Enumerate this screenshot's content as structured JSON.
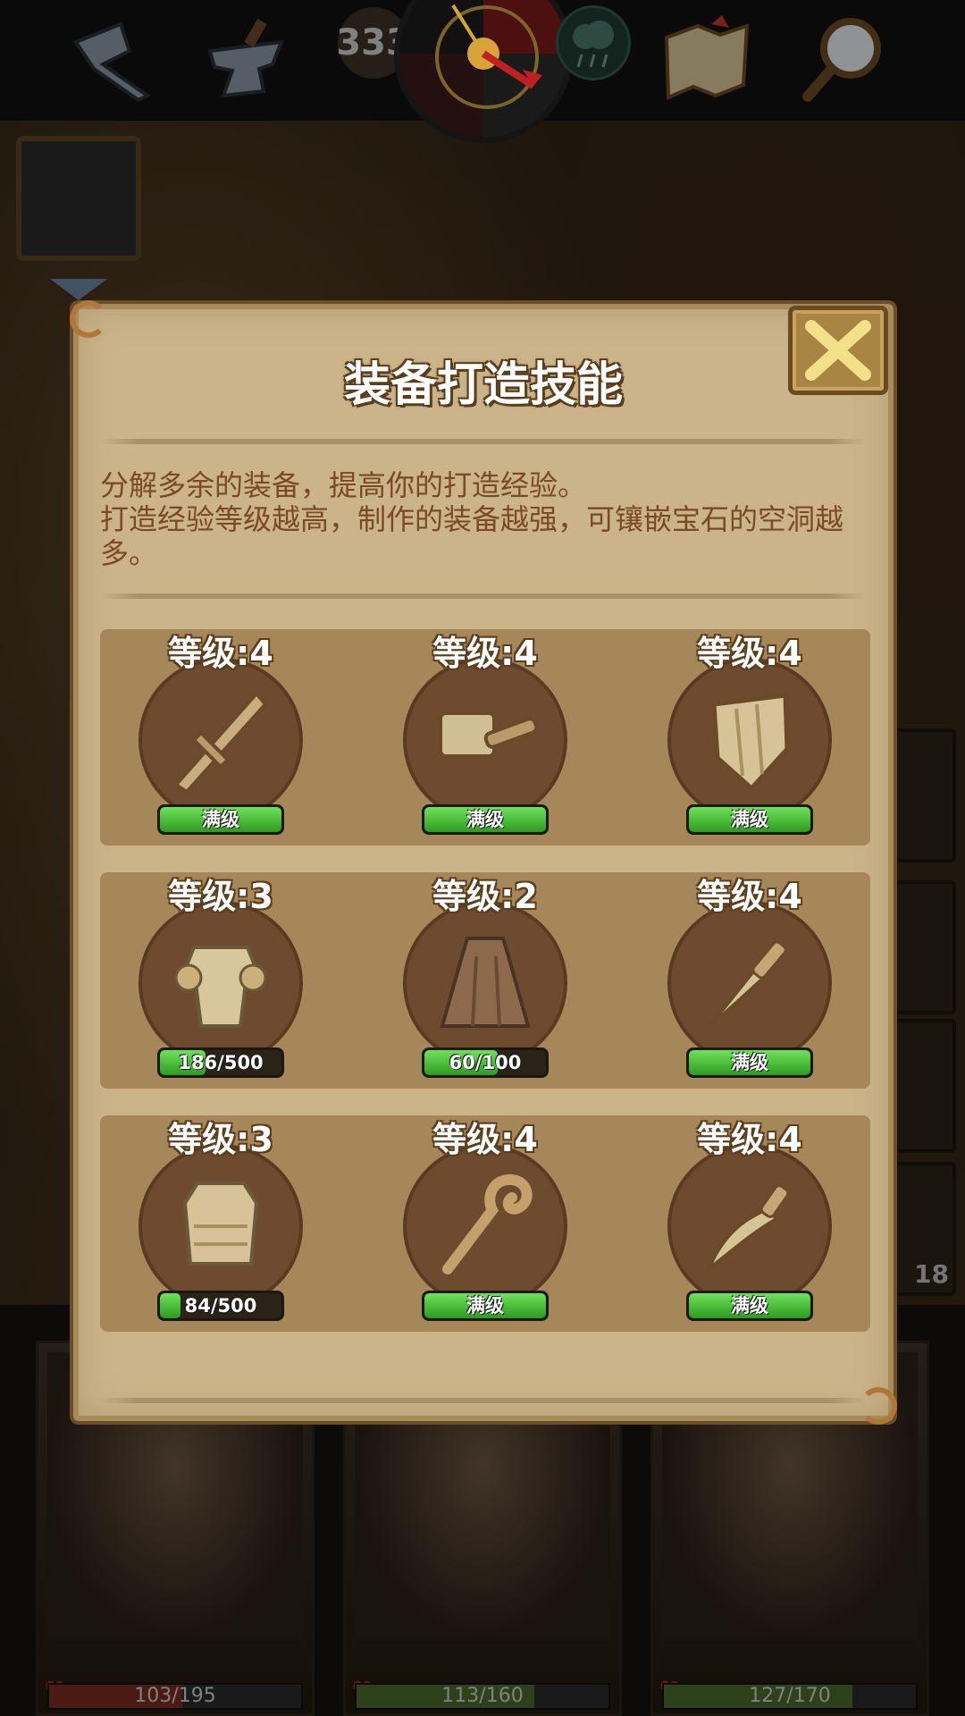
{
  "hud": {
    "counter": "333",
    "icons": [
      "pickaxe-icon",
      "anvil-icon",
      "compass-icon",
      "weather-icon",
      "treasure-map-icon",
      "magnifier-icon"
    ]
  },
  "side": {
    "slot_number": "18"
  },
  "dialog": {
    "title": "装备打造技能",
    "description_lines": [
      "分解多余的装备，提高你的打造经验。",
      "打造经验等级越高，制作的装备越强，可镶嵌宝石的空洞越多。"
    ],
    "skills": [
      {
        "level_label": "等级:4",
        "item": "greatsword-icon",
        "progress_label": "满级",
        "progress": 1.0
      },
      {
        "level_label": "等级:4",
        "item": "hammer-icon",
        "progress_label": "满级",
        "progress": 1.0
      },
      {
        "level_label": "等级:4",
        "item": "shield-icon",
        "progress_label": "满级",
        "progress": 1.0
      },
      {
        "level_label": "等级:3",
        "item": "plate-armor-icon",
        "progress_label": "186/500",
        "progress": 0.372
      },
      {
        "level_label": "等级:2",
        "item": "cloak-icon",
        "progress_label": "60/100",
        "progress": 0.6
      },
      {
        "level_label": "等级:4",
        "item": "dagger-icon",
        "progress_label": "满级",
        "progress": 1.0
      },
      {
        "level_label": "等级:3",
        "item": "chest-armor-icon",
        "progress_label": "84/500",
        "progress": 0.168
      },
      {
        "level_label": "等级:4",
        "item": "staff-icon",
        "progress_label": "满级",
        "progress": 1.0
      },
      {
        "level_label": "等级:4",
        "item": "curved-knife-icon",
        "progress_label": "满级",
        "progress": 1.0
      }
    ]
  },
  "party": [
    {
      "hp_label": "103/195",
      "hp": 0.528,
      "hp_color": "#7a2a1e"
    },
    {
      "hp_label": "113/160",
      "hp": 0.706,
      "hp_color": "#4a6b2a"
    },
    {
      "hp_label": "127/170",
      "hp": 0.747,
      "hp_color": "#4a6b2a"
    }
  ],
  "colors": {
    "dialog_bg": "#cbb489",
    "description_text": "#7a4a22",
    "progress_green": "#3fb52c"
  }
}
